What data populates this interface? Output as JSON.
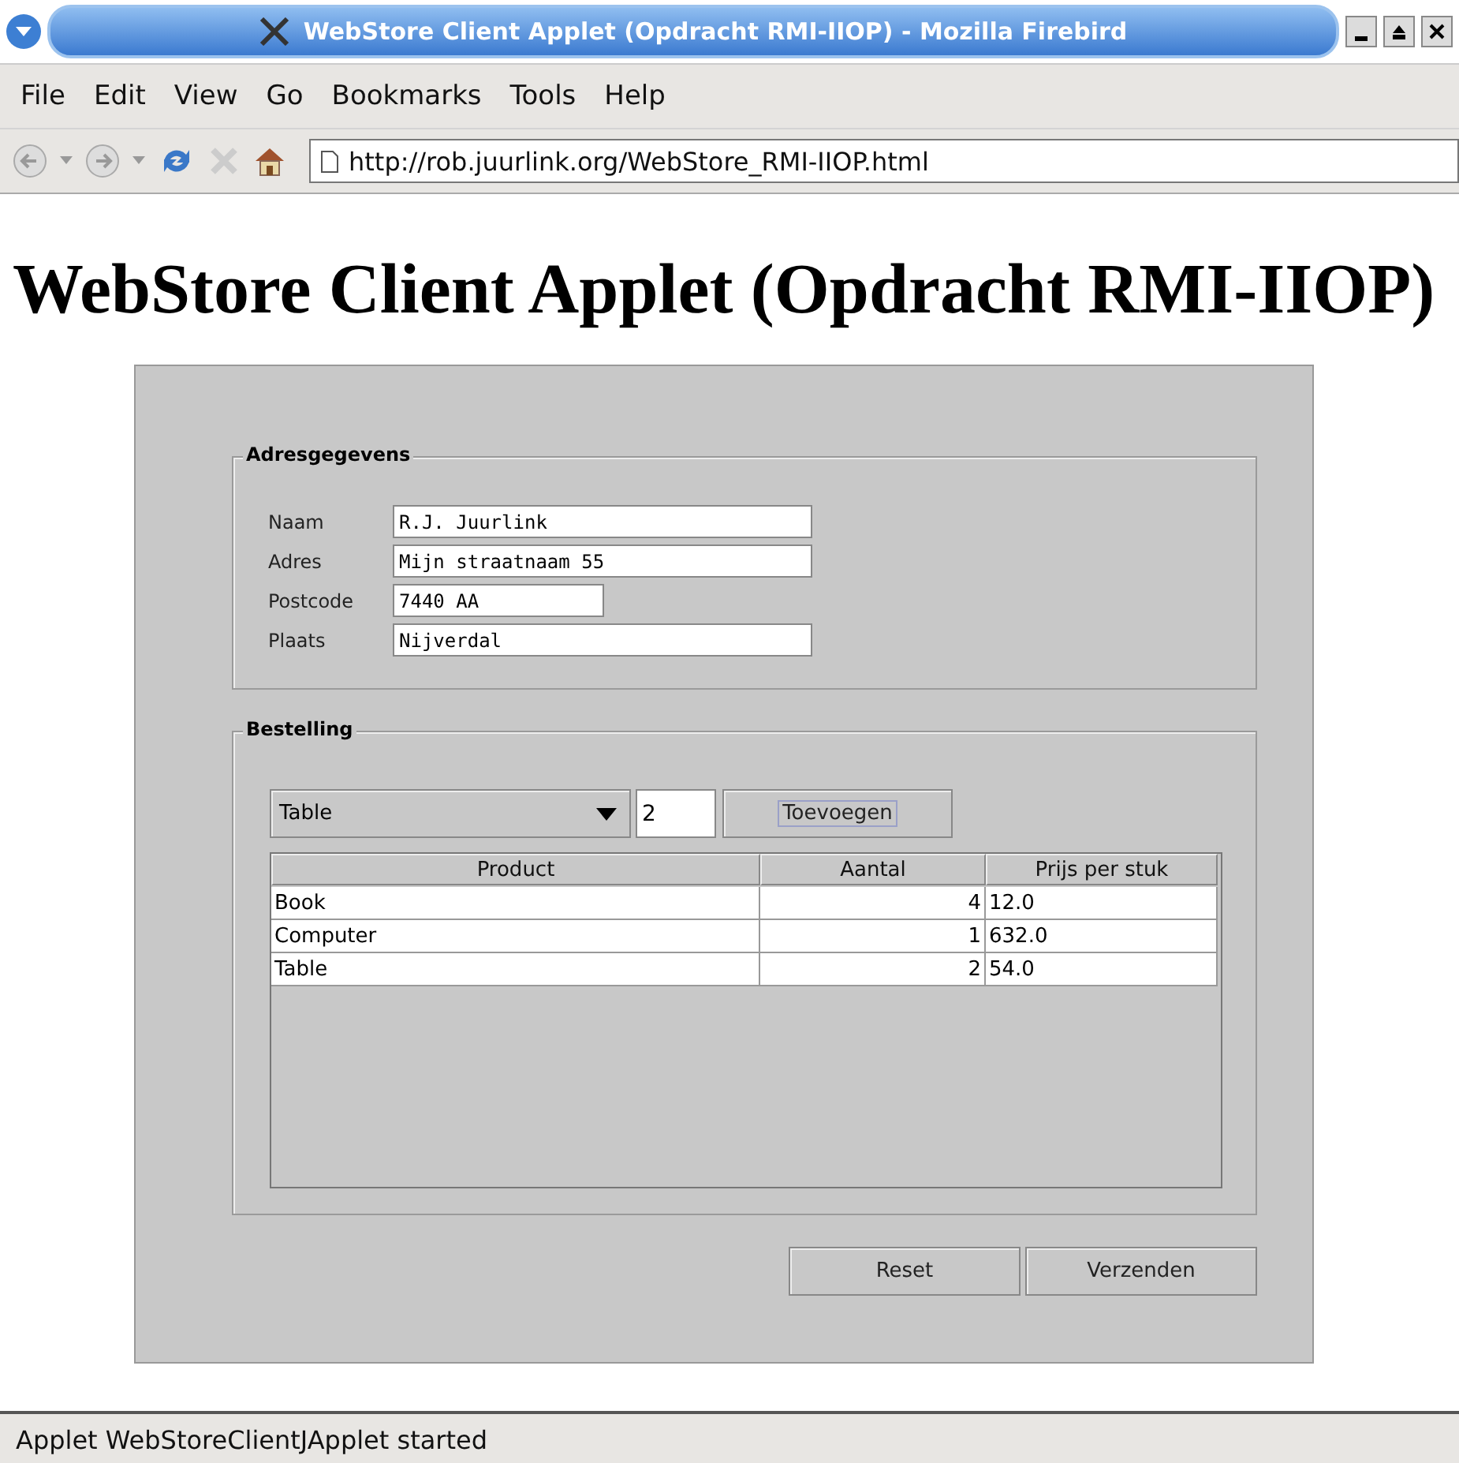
{
  "window": {
    "title": "WebStore Client Applet (Opdracht RMI-IIOP) - Mozilla Firebird"
  },
  "menu": [
    "File",
    "Edit",
    "View",
    "Go",
    "Bookmarks",
    "Tools",
    "Help"
  ],
  "address_bar": {
    "value": "http://rob.juurlink.org/WebStore_RMI-IIOP.html"
  },
  "page": {
    "heading": "WebStore Client Applet (Opdracht RMI-IIOP)",
    "address": {
      "legend": "Adresgegevens",
      "fields": [
        {
          "label": "Naam",
          "value": "R.J. Juurlink"
        },
        {
          "label": "Adres",
          "value": "Mijn straatnaam 55"
        },
        {
          "label": "Postcode",
          "value": "7440 AA"
        },
        {
          "label": "Plaats",
          "value": "Nijverdal"
        }
      ]
    },
    "order": {
      "legend": "Bestelling",
      "product_select": "Table",
      "quantity": "2",
      "add_button": "Toevoegen",
      "table": {
        "columns": [
          "Product",
          "Aantal",
          "Prijs per stuk"
        ],
        "rows": [
          [
            "Book",
            "4",
            "12.0"
          ],
          [
            "Computer",
            "1",
            "632.0"
          ],
          [
            "Table",
            "2",
            "54.0"
          ]
        ]
      }
    },
    "buttons": [
      "Reset",
      "Verzenden"
    ]
  },
  "status_bar": "Applet WebStoreClientJApplet started"
}
